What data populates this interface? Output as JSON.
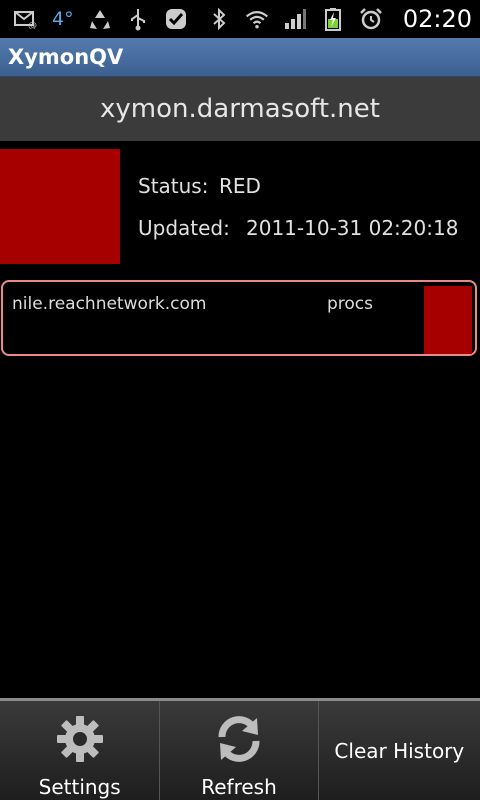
{
  "status_bar": {
    "temperature": "4°",
    "time": "02:20",
    "icons": [
      "mail-icon",
      "weather-icon",
      "recycle-icon",
      "usb-icon",
      "check-shield-icon",
      "bluetooth-icon",
      "wifi-icon",
      "signal-icon",
      "battery-icon",
      "alarm-icon"
    ]
  },
  "app": {
    "title": "XymonQV"
  },
  "server": {
    "name": "xymon.darmasoft.net"
  },
  "overall": {
    "status_label": "Status:",
    "status_value": "RED",
    "updated_label": "Updated:",
    "updated_value": "2011-10-31 02:20:18",
    "status_color": "#a60000"
  },
  "hosts": [
    {
      "name": "nile.reachnetwork.com",
      "test": "procs",
      "color": "#a60000",
      "border_color": "#e88a8a"
    }
  ],
  "menu": {
    "settings": "Settings",
    "refresh": "Refresh",
    "clear_history": "Clear History"
  },
  "colors": {
    "title_bar": "#4a6fa2",
    "header_bg": "#3b3b3b",
    "alert_red": "#a60000",
    "temp_blue": "#5aa8e8"
  }
}
